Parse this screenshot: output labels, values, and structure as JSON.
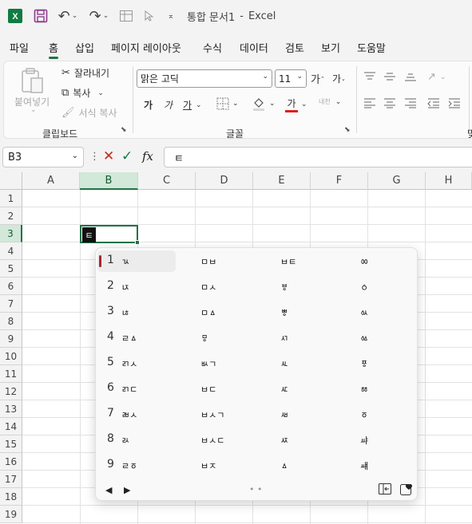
{
  "titlebar": {
    "app_icon": "excel-logo-icon",
    "doc_title": "통합 문서1",
    "separator": "-",
    "app_name": "Excel"
  },
  "menu": [
    "파일",
    "홈",
    "삽입",
    "페이지 레이아웃",
    "수식",
    "데이터",
    "검토",
    "보기",
    "도움말"
  ],
  "menu_active": "홈",
  "ribbon": {
    "clipboard": {
      "paste": "붙여넣기",
      "cut": "잘라내기",
      "copy": "복사",
      "format_painter": "서식 복사",
      "group_label": "클립보드"
    },
    "font": {
      "font_name": "맑은 고딕",
      "font_size": "11",
      "grow": "가",
      "shrink": "가",
      "bold": "가",
      "italic": "가",
      "underline": "가",
      "font_color": "가",
      "phonetic": "내천",
      "group_label": "글꼴"
    },
    "next_group_label_partial": "맞"
  },
  "formula_bar": {
    "name_box": "B3",
    "formula_value": "ㅌ",
    "fx_label": "fx"
  },
  "sheet": {
    "columns": [
      "A",
      "B",
      "C",
      "D",
      "E",
      "F",
      "G",
      "H"
    ],
    "rows": [
      "1",
      "2",
      "3",
      "4",
      "5",
      "6",
      "7",
      "8",
      "9",
      "10",
      "11",
      "12",
      "13",
      "14",
      "15",
      "16",
      "17",
      "18",
      "19"
    ],
    "selected_col": "B",
    "selected_row": "3",
    "active_cell_text": "ㅌ"
  },
  "ime": {
    "rows": [
      {
        "num": "1",
        "c": [
          "ㄳ",
          "ㅁㅂ",
          "ㅂㅌ",
          "ㆀ"
        ]
      },
      {
        "num": "2",
        "c": [
          "ㄵ",
          "ㅁㅅ",
          "ㅸ",
          "ㆁ"
        ]
      },
      {
        "num": "3",
        "c": [
          "ㄶ",
          "ㅁㅿ",
          "ㅹ",
          "ㆂ"
        ]
      },
      {
        "num": "4",
        "c": [
          "ㄹㅿ",
          "ㅱ",
          "ㅺ",
          "ㆃ"
        ]
      },
      {
        "num": "5",
        "c": [
          "ㄺㅅ",
          "ㅄㄱ",
          "ㅻ",
          "ㆄ"
        ]
      },
      {
        "num": "6",
        "c": [
          "ㄺㄷ",
          "ㅂㄷ",
          "ㅼ",
          "ㆅ"
        ]
      },
      {
        "num": "7",
        "c": [
          "ㄼㅅ",
          "ㅂㅅㄱ",
          "ㅽ",
          "ㆆ"
        ]
      },
      {
        "num": "8",
        "c": [
          "ㄽ",
          "ㅂㅅㄷ",
          "ㅾ",
          "ㆇ"
        ]
      },
      {
        "num": "9",
        "c": [
          "ㄹㆆ",
          "ㅂㅈ",
          "ㅿ",
          "ㆈ"
        ]
      }
    ],
    "footer": {
      "prev": "◀",
      "next": "▶",
      "dots": "• •"
    }
  }
}
